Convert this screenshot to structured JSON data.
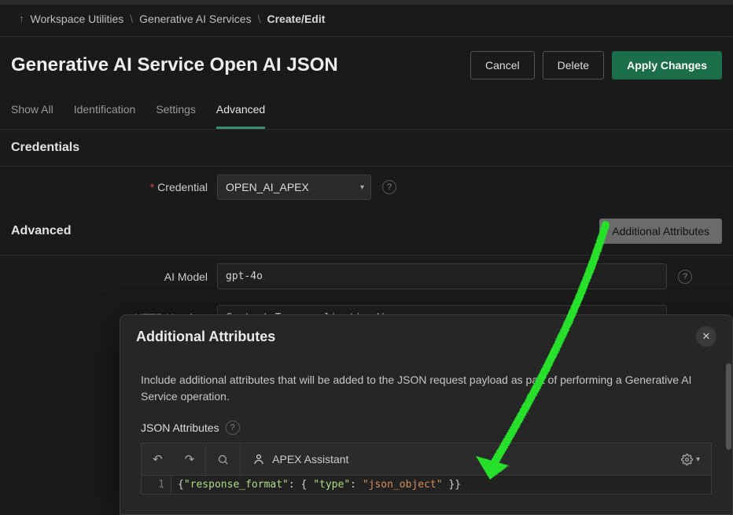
{
  "breadcrumb": {
    "items": [
      "Workspace Utilities",
      "Generative AI Services",
      "Create/Edit"
    ]
  },
  "header": {
    "title": "Generative AI Service Open AI JSON",
    "cancel": "Cancel",
    "delete": "Delete",
    "apply": "Apply Changes"
  },
  "tabs": [
    "Show All",
    "Identification",
    "Settings",
    "Advanced"
  ],
  "activeTabIndex": 3,
  "sections": {
    "credentials": {
      "title": "Credentials",
      "credential_label": "Credential",
      "credential_value": "OPEN_AI_APEX"
    },
    "advanced": {
      "title": "Advanced",
      "additional_attributes_btn": "Additional Attributes",
      "ai_model_label": "AI Model",
      "ai_model_value": "gpt-4o",
      "http_headers_label": "HTTP Headers",
      "http_headers_value": "Content-Type=application/json"
    }
  },
  "dialog": {
    "title": "Additional Attributes",
    "description": "Include additional attributes that will be added to the JSON request payload as part of performing a Generative AI Service operation.",
    "json_attributes_label": "JSON Attributes",
    "apex_assistant": "APEX Assistant",
    "code_tokens": {
      "lbrace": "{",
      "key1": "\"response_format\"",
      "colon": ": ",
      "lbrace2": "{ ",
      "key2": "\"type\"",
      "colon2": ": ",
      "str": "\"json_object\"",
      "rbraces": " }}"
    },
    "line_no": "1"
  }
}
